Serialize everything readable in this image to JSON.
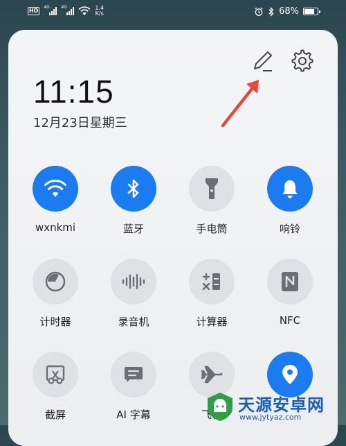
{
  "status_bar": {
    "net_badge": "HD",
    "signal_type_1": "4G",
    "signal_type_2": "4G",
    "speed_value": "1.4",
    "speed_unit": "K/s",
    "battery_text": "68%",
    "battery_level": 0.68
  },
  "clock": {
    "time": "11:15",
    "date": "12月23日星期三"
  },
  "toolbar": {
    "edit_icon": "pencil-icon",
    "settings_icon": "gear-icon"
  },
  "tiles": [
    {
      "label": "wxnkmi",
      "icon": "wifi-icon",
      "active": true
    },
    {
      "label": "蓝牙",
      "icon": "bluetooth-icon",
      "active": true
    },
    {
      "label": "手电筒",
      "icon": "flashlight-icon",
      "active": false
    },
    {
      "label": "响铃",
      "icon": "bell-icon",
      "active": true
    },
    {
      "label": "计时器",
      "icon": "timer-icon",
      "active": false
    },
    {
      "label": "录音机",
      "icon": "waveform-icon",
      "active": false
    },
    {
      "label": "计算器",
      "icon": "calculator-icon",
      "active": false
    },
    {
      "label": "NFC",
      "icon": "nfc-icon",
      "active": false
    },
    {
      "label": "截屏",
      "icon": "screenshot-icon",
      "active": false
    },
    {
      "label": "AI 字幕",
      "icon": "caption-icon",
      "active": false
    },
    {
      "label": "飞行",
      "icon": "airplane-icon",
      "active": false
    },
    {
      "label": "",
      "icon": "location-icon",
      "active": true
    }
  ],
  "colors": {
    "accent": "#1a7cf0",
    "tile_off": "#dfe1e4",
    "arrow": "#e8483a"
  },
  "watermark": {
    "text": "天源安卓网",
    "url": "www.jytyaz.com"
  }
}
